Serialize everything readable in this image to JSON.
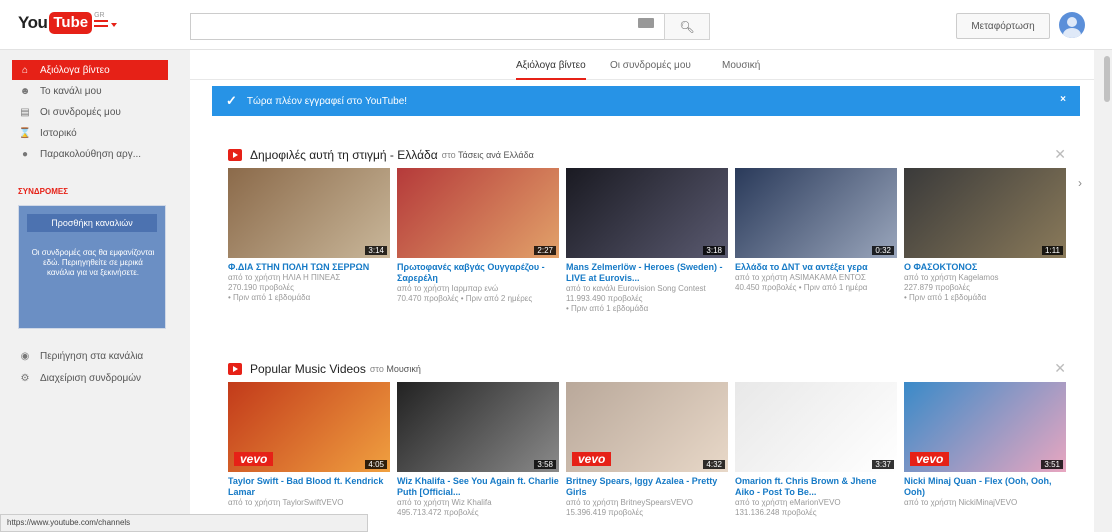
{
  "header": {
    "logo_you": "You",
    "logo_tube": "Tube",
    "logo_region": "GR",
    "upload_label": "Μεταφόρτωση"
  },
  "sidebar": {
    "items": [
      {
        "label": "Αξιόλογα βίντεο",
        "icon": "home-icon",
        "active": true
      },
      {
        "label": "Το κανάλι μου",
        "icon": "user-icon",
        "active": false
      },
      {
        "label": "Οι συνδρομές μου",
        "icon": "subscriptions-icon",
        "active": false
      },
      {
        "label": "Ιστορικό",
        "icon": "history-icon",
        "active": false
      },
      {
        "label": "Παρακολούθηση αργ...",
        "icon": "clock-icon",
        "active": false
      }
    ],
    "subs_heading": "ΣΥΝΔΡΟΜΕΣ",
    "add_channel_label": "Προσθήκη καναλιών",
    "subs_text": "Οι συνδρομές σας θα εμφανίζονται εδώ. Περιηγηθείτε σε μερικά κανάλια για να ξεκινήσετε.",
    "bottom_items": [
      {
        "label": "Περιήγηση στα κανάλια",
        "icon": "browse-icon"
      },
      {
        "label": "Διαχείριση συνδρομών",
        "icon": "manage-icon"
      }
    ]
  },
  "tabs": [
    {
      "label": "Αξιόλογα βίντεο",
      "active": true
    },
    {
      "label": "Οι συνδρομές μου",
      "active": false
    },
    {
      "label": "Μουσική",
      "active": false
    }
  ],
  "banner": {
    "text": "Τώρα πλέον εγγραφεί στο YouTube!",
    "close": "×"
  },
  "shelves": [
    {
      "title": "Δημοφιλές αυτή τη στιγμή - Ελλάδα",
      "sub_prefix": "στο",
      "sub_channel": "Τάσεις ανά Ελλάδα",
      "icon": "trending-icon",
      "videos": [
        {
          "title": "Φ.ΔΙΑ ΣΤΗΝ ΠΟΛΗ ΤΩΝ ΣΕΡΡΩΝ",
          "meta1": "από το χρήστη ΗΛΙΑ Η ΠΙΝΕΑΣ",
          "meta2": "270.190 προβολές",
          "meta3": "• Πριν από 1 εβδομάδα",
          "duration": "3:14",
          "colors": [
            "#8b6a4a",
            "#c9b79a"
          ],
          "vevo": false
        },
        {
          "title": "Πρωτοφανές καβγάς Ουγγαρέζου - Σαρερέλη",
          "meta1": "από το χρήστη Ιαρμπαρ ενώ",
          "meta2": "70.470 προβολές • Πριν από 2 ημέρες",
          "meta3": "",
          "duration": "2:27",
          "colors": [
            "#b53a3a",
            "#e2a26a"
          ],
          "vevo": false
        },
        {
          "title": "Mans Zelmerlöw - Heroes (Sweden) - LIVE at Eurovis...",
          "meta1": "από το κανάλι Eurovision Song Contest",
          "meta2": "11.993.490 προβολές",
          "meta3": "• Πριν από 1 εβδομάδα",
          "duration": "3:18",
          "colors": [
            "#1a1a22",
            "#5a5a70"
          ],
          "vevo": false
        },
        {
          "title": "Ελλάδα το ΔΝΤ να αντέξει γερα",
          "meta1": "από το χρήστη ASIMAKAMA ΕΝΤΟΣ",
          "meta2": "40.450 προβολές • Πριν από 1 ημέρα",
          "meta3": "",
          "duration": "0:32",
          "colors": [
            "#2a3a5a",
            "#9aa6bc"
          ],
          "vevo": false
        },
        {
          "title": "Ο ΦΑΣΟΚΤΟΝΟΣ",
          "meta1": "από το χρήστη Kagelamos",
          "meta2": "227.879 προβολές",
          "meta3": "• Πριν από 1 εβδομάδα",
          "duration": "1:11",
          "colors": [
            "#3a3a3a",
            "#8a7a5a"
          ],
          "vevo": false
        }
      ]
    },
    {
      "title": "Popular Music Videos",
      "sub_prefix": "στο",
      "sub_channel": "Μουσική",
      "icon": "music-icon",
      "videos": [
        {
          "title": "Taylor Swift - Bad Blood ft. Kendrick Lamar",
          "meta1": "από το χρήστη TaylorSwiftVEVO",
          "meta2": "",
          "meta3": "",
          "duration": "4:05",
          "colors": [
            "#c23a1a",
            "#f0a040"
          ],
          "vevo": true
        },
        {
          "title": "Wiz Khalifa - See You Again ft. Charlie Puth [Official...",
          "meta1": "από το χρήστη Wiz Khalifa",
          "meta2": "495.713.472 προβολές",
          "meta3": "",
          "duration": "3:58",
          "colors": [
            "#222222",
            "#8a8a8a"
          ],
          "vevo": false
        },
        {
          "title": "Britney Spears, Iggy Azalea - Pretty Girls",
          "meta1": "από το χρήστη BritneySpearsVEVO",
          "meta2": "15.396.419 προβολές",
          "meta3": "",
          "duration": "4:32",
          "colors": [
            "#b9a89a",
            "#e8d8c8"
          ],
          "vevo": true
        },
        {
          "title": "Omarion ft. Chris Brown & Jhene Aiko - Post To Be...",
          "meta1": "από το χρήστη eMarionVEVO",
          "meta2": "131.136.248 προβολές",
          "meta3": "",
          "duration": "3:37",
          "colors": [
            "#e8e8e8",
            "#ffffff"
          ],
          "vevo": false
        },
        {
          "title": "Nicki Minaj Quan - Flex (Ooh, Ooh, Ooh)",
          "meta1": "από το χρήστη NickiMinajVEVO",
          "meta2": "",
          "meta3": "",
          "duration": "3:51",
          "colors": [
            "#3a8ac8",
            "#e8a6c0"
          ],
          "vevo": true
        }
      ]
    }
  ],
  "status_url": "https://www.youtube.com/channels"
}
